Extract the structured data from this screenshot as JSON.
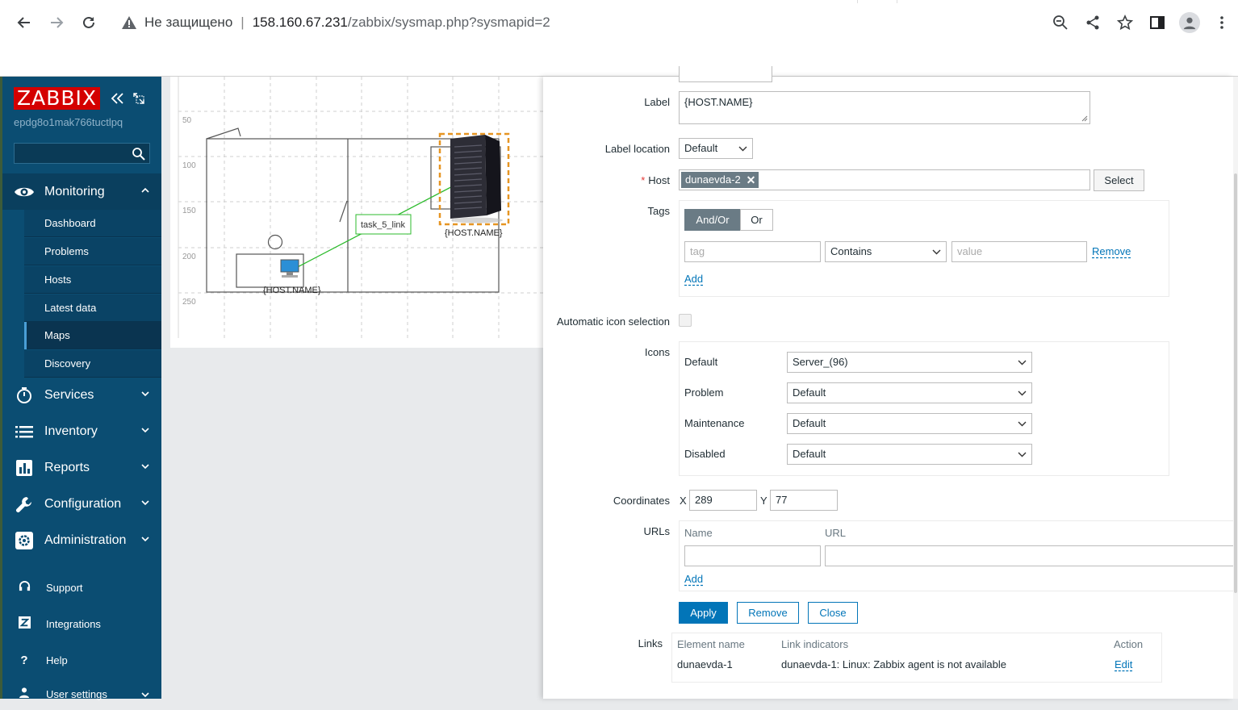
{
  "browser": {
    "insecure_label": "Не защищено",
    "host": "158.160.67.231",
    "path": "/zabbix/sysmap.php?sysmapid=2"
  },
  "sidebar": {
    "logo": "ZABBIX",
    "server_name": "epdg8o1mak766tuctlpq",
    "sections": [
      {
        "label": "Monitoring",
        "icon": "eye-icon"
      },
      {
        "label": "Services",
        "icon": "stopwatch-icon"
      },
      {
        "label": "Inventory",
        "icon": "list-icon"
      },
      {
        "label": "Reports",
        "icon": "bar-chart-icon"
      },
      {
        "label": "Configuration",
        "icon": "wrench-icon"
      },
      {
        "label": "Administration",
        "icon": "gear-icon"
      }
    ],
    "monitoring_items": [
      "Dashboard",
      "Problems",
      "Hosts",
      "Latest data",
      "Maps",
      "Discovery"
    ],
    "footer": [
      {
        "label": "Support",
        "icon": "headset-icon"
      },
      {
        "label": "Integrations",
        "icon": "z-icon"
      },
      {
        "label": "Help",
        "icon": "question-icon"
      },
      {
        "label": "User settings",
        "icon": "user-icon"
      }
    ]
  },
  "map": {
    "y_ticks": [
      "50",
      "100",
      "150",
      "200",
      "250"
    ],
    "link_label": "task_5_link",
    "host_label_1": "{HOST.NAME}",
    "host_label_2": "{HOST.NAME}"
  },
  "form": {
    "label_label": "Label",
    "label_value": "{HOST.NAME}",
    "label_location_label": "Label location",
    "label_location_value": "Default",
    "host_label": "Host",
    "host_value": "dunaevda-2",
    "host_select_button": "Select",
    "tags_label": "Tags",
    "tags_andor": "And/Or",
    "tags_or": "Or",
    "tag_placeholder": "tag",
    "tag_operator": "Contains",
    "value_placeholder": "value",
    "tag_remove": "Remove",
    "tag_add": "Add",
    "auto_icon_label": "Automatic icon selection",
    "icons_label": "Icons",
    "icons": [
      {
        "label": "Default",
        "value": "Server_(96)"
      },
      {
        "label": "Problem",
        "value": "Default"
      },
      {
        "label": "Maintenance",
        "value": "Default"
      },
      {
        "label": "Disabled",
        "value": "Default"
      }
    ],
    "coordinates_label": "Coordinates",
    "x_label": "X",
    "x_value": "289",
    "y_label": "Y",
    "y_value": "77",
    "urls_label": "URLs",
    "urls_name_header": "Name",
    "urls_url_header": "URL",
    "urls_add": "Add",
    "apply_button": "Apply",
    "remove_button": "Remove",
    "close_button": "Close",
    "links_label": "Links",
    "links_headers": {
      "element": "Element name",
      "indicators": "Link indicators",
      "action": "Action"
    },
    "links_rows": [
      {
        "element": "dunaevda-1",
        "indicators": "dunaevda-1: Linux: Zabbix agent is not available",
        "action": "Edit"
      }
    ]
  }
}
